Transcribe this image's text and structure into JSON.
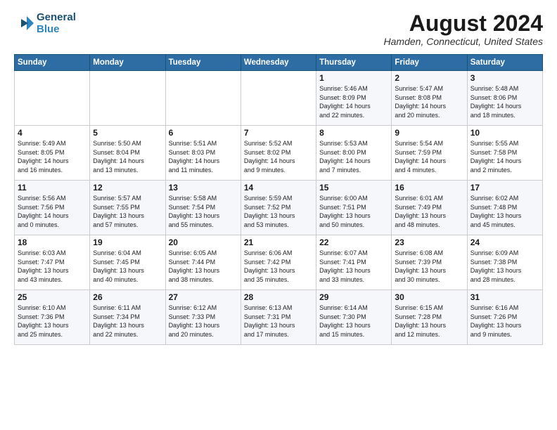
{
  "header": {
    "logo_line1": "General",
    "logo_line2": "Blue",
    "month_year": "August 2024",
    "location": "Hamden, Connecticut, United States"
  },
  "weekdays": [
    "Sunday",
    "Monday",
    "Tuesday",
    "Wednesday",
    "Thursday",
    "Friday",
    "Saturday"
  ],
  "weeks": [
    [
      {
        "day": "",
        "content": ""
      },
      {
        "day": "",
        "content": ""
      },
      {
        "day": "",
        "content": ""
      },
      {
        "day": "",
        "content": ""
      },
      {
        "day": "1",
        "content": "Sunrise: 5:46 AM\nSunset: 8:09 PM\nDaylight: 14 hours\nand 22 minutes."
      },
      {
        "day": "2",
        "content": "Sunrise: 5:47 AM\nSunset: 8:08 PM\nDaylight: 14 hours\nand 20 minutes."
      },
      {
        "day": "3",
        "content": "Sunrise: 5:48 AM\nSunset: 8:06 PM\nDaylight: 14 hours\nand 18 minutes."
      }
    ],
    [
      {
        "day": "4",
        "content": "Sunrise: 5:49 AM\nSunset: 8:05 PM\nDaylight: 14 hours\nand 16 minutes."
      },
      {
        "day": "5",
        "content": "Sunrise: 5:50 AM\nSunset: 8:04 PM\nDaylight: 14 hours\nand 13 minutes."
      },
      {
        "day": "6",
        "content": "Sunrise: 5:51 AM\nSunset: 8:03 PM\nDaylight: 14 hours\nand 11 minutes."
      },
      {
        "day": "7",
        "content": "Sunrise: 5:52 AM\nSunset: 8:02 PM\nDaylight: 14 hours\nand 9 minutes."
      },
      {
        "day": "8",
        "content": "Sunrise: 5:53 AM\nSunset: 8:00 PM\nDaylight: 14 hours\nand 7 minutes."
      },
      {
        "day": "9",
        "content": "Sunrise: 5:54 AM\nSunset: 7:59 PM\nDaylight: 14 hours\nand 4 minutes."
      },
      {
        "day": "10",
        "content": "Sunrise: 5:55 AM\nSunset: 7:58 PM\nDaylight: 14 hours\nand 2 minutes."
      }
    ],
    [
      {
        "day": "11",
        "content": "Sunrise: 5:56 AM\nSunset: 7:56 PM\nDaylight: 14 hours\nand 0 minutes."
      },
      {
        "day": "12",
        "content": "Sunrise: 5:57 AM\nSunset: 7:55 PM\nDaylight: 13 hours\nand 57 minutes."
      },
      {
        "day": "13",
        "content": "Sunrise: 5:58 AM\nSunset: 7:54 PM\nDaylight: 13 hours\nand 55 minutes."
      },
      {
        "day": "14",
        "content": "Sunrise: 5:59 AM\nSunset: 7:52 PM\nDaylight: 13 hours\nand 53 minutes."
      },
      {
        "day": "15",
        "content": "Sunrise: 6:00 AM\nSunset: 7:51 PM\nDaylight: 13 hours\nand 50 minutes."
      },
      {
        "day": "16",
        "content": "Sunrise: 6:01 AM\nSunset: 7:49 PM\nDaylight: 13 hours\nand 48 minutes."
      },
      {
        "day": "17",
        "content": "Sunrise: 6:02 AM\nSunset: 7:48 PM\nDaylight: 13 hours\nand 45 minutes."
      }
    ],
    [
      {
        "day": "18",
        "content": "Sunrise: 6:03 AM\nSunset: 7:47 PM\nDaylight: 13 hours\nand 43 minutes."
      },
      {
        "day": "19",
        "content": "Sunrise: 6:04 AM\nSunset: 7:45 PM\nDaylight: 13 hours\nand 40 minutes."
      },
      {
        "day": "20",
        "content": "Sunrise: 6:05 AM\nSunset: 7:44 PM\nDaylight: 13 hours\nand 38 minutes."
      },
      {
        "day": "21",
        "content": "Sunrise: 6:06 AM\nSunset: 7:42 PM\nDaylight: 13 hours\nand 35 minutes."
      },
      {
        "day": "22",
        "content": "Sunrise: 6:07 AM\nSunset: 7:41 PM\nDaylight: 13 hours\nand 33 minutes."
      },
      {
        "day": "23",
        "content": "Sunrise: 6:08 AM\nSunset: 7:39 PM\nDaylight: 13 hours\nand 30 minutes."
      },
      {
        "day": "24",
        "content": "Sunrise: 6:09 AM\nSunset: 7:38 PM\nDaylight: 13 hours\nand 28 minutes."
      }
    ],
    [
      {
        "day": "25",
        "content": "Sunrise: 6:10 AM\nSunset: 7:36 PM\nDaylight: 13 hours\nand 25 minutes."
      },
      {
        "day": "26",
        "content": "Sunrise: 6:11 AM\nSunset: 7:34 PM\nDaylight: 13 hours\nand 22 minutes."
      },
      {
        "day": "27",
        "content": "Sunrise: 6:12 AM\nSunset: 7:33 PM\nDaylight: 13 hours\nand 20 minutes."
      },
      {
        "day": "28",
        "content": "Sunrise: 6:13 AM\nSunset: 7:31 PM\nDaylight: 13 hours\nand 17 minutes."
      },
      {
        "day": "29",
        "content": "Sunrise: 6:14 AM\nSunset: 7:30 PM\nDaylight: 13 hours\nand 15 minutes."
      },
      {
        "day": "30",
        "content": "Sunrise: 6:15 AM\nSunset: 7:28 PM\nDaylight: 13 hours\nand 12 minutes."
      },
      {
        "day": "31",
        "content": "Sunrise: 6:16 AM\nSunset: 7:26 PM\nDaylight: 13 hours\nand 9 minutes."
      }
    ]
  ]
}
